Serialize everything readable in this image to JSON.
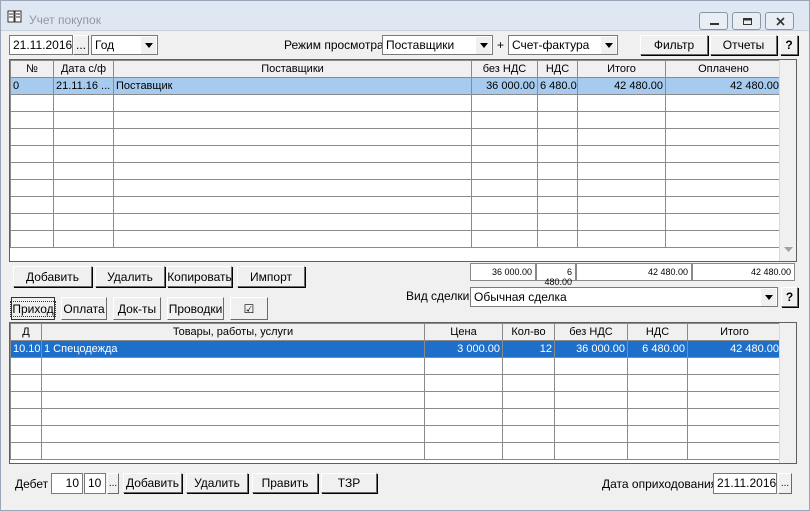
{
  "window": {
    "title": "Учет покупок"
  },
  "toolbar": {
    "date": "21.11.2016",
    "date_button": "...",
    "period": "Год",
    "view_mode_label": "Режим просмотра:",
    "view_mode": "Поставщики",
    "plus": "+",
    "doc_type": "Счет-фактура",
    "filter_label": "Фильтр",
    "reports_label": "Отчеты",
    "help": "?"
  },
  "invoices": {
    "columns": [
      "№",
      "Дата с/ф",
      "Поставщики",
      "без НДС",
      "НДС",
      "Итого",
      "Оплачено"
    ],
    "rows": [
      [
        "0",
        "21.11.16 ...",
        "Поставщик",
        "36 000.00",
        "6 480.00",
        "42 480.00",
        "42 480.00"
      ]
    ],
    "totals": {
      "net": "36 000.00",
      "vat": "6 480.00",
      "total": "42 480.00",
      "paid": "42 480.00"
    }
  },
  "invoice_buttons": {
    "add": "Добавить",
    "delete": "Удалить",
    "copy": "Копировать",
    "import": "Импорт"
  },
  "deal": {
    "label": "Вид сделки",
    "value": "Обычная сделка",
    "help": "?"
  },
  "tabs": [
    "Приход",
    "Оплата",
    "Док-ты",
    "Проводки",
    "☑"
  ],
  "items": {
    "columns": [
      "Д",
      "Товары, работы, услуги",
      "Цена",
      "Кол-во",
      "без НДС",
      "НДС",
      "Итого"
    ],
    "rows": [
      [
        "10.10",
        "1 Спецодежда",
        "3 000.00",
        "12",
        "36 000.00",
        "6 480.00",
        "42 480.00"
      ]
    ]
  },
  "bottom": {
    "debit_label": "Дебет",
    "debit_account": "10",
    "debit_sub": "10",
    "dots": "...",
    "add": "Добавить",
    "delete": "Удалить",
    "edit": "Править",
    "tzr": "ТЗР",
    "posting_date_label": "Дата оприходования",
    "posting_date": "21.11.2016"
  }
}
